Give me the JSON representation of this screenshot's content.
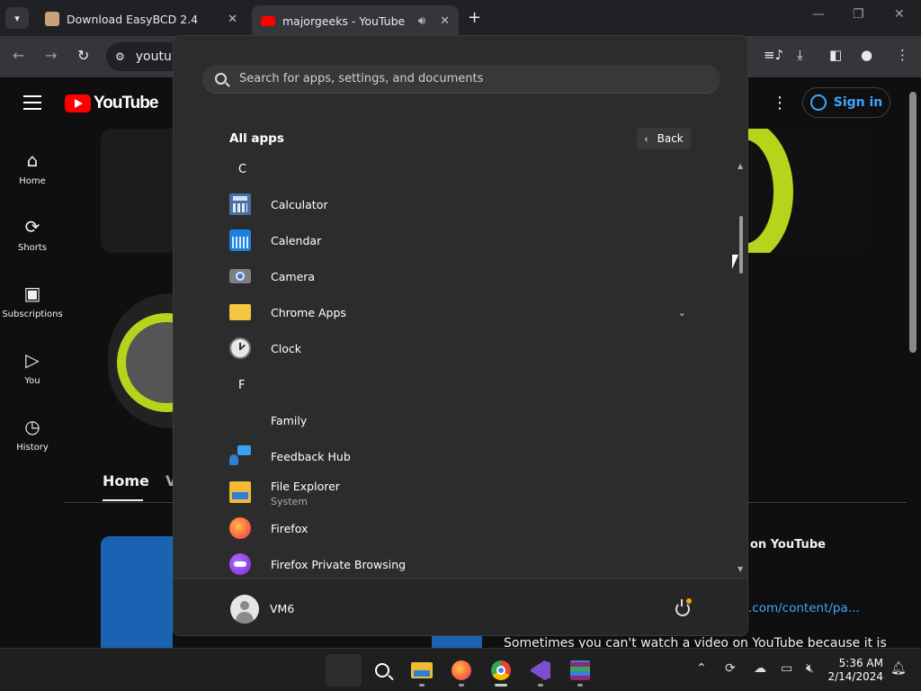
{
  "browser": {
    "tabs": [
      {
        "title": "Download EasyBCD 2.4",
        "favicon": "easybcd-icon"
      },
      {
        "title": "majorgeeks - YouTube",
        "favicon": "youtube-icon",
        "active": true
      }
    ],
    "address_text": "youtu",
    "window_controls": {
      "minimize": "—",
      "maximize": "❐",
      "close": "✕"
    }
  },
  "youtube": {
    "logo_text": "YouTube",
    "sidebar": [
      {
        "label": "Home",
        "icon": "home-icon"
      },
      {
        "label": "Shorts",
        "icon": "shorts-icon"
      },
      {
        "label": "Subscriptions",
        "icon": "subscriptions-icon"
      },
      {
        "label": "You",
        "icon": "you-icon"
      },
      {
        "label": "History",
        "icon": "history-icon"
      }
    ],
    "sign_in": "Sign in",
    "channel_tabs": {
      "home": "Home",
      "videos_partial": "V"
    },
    "about_title": "on YouTube",
    "about_link": ".com/content/pa...",
    "about_desc": "Sometimes you can't watch a video on YouTube because it is"
  },
  "start_menu": {
    "search_placeholder": "Search for apps, settings, and documents",
    "all_apps_title": "All apps",
    "back_label": "Back",
    "letters": {
      "c": "C",
      "f": "F"
    },
    "apps": [
      {
        "name": "Calculator",
        "icon": "calculator-icon"
      },
      {
        "name": "Calendar",
        "icon": "calendar-icon"
      },
      {
        "name": "Camera",
        "icon": "camera-icon"
      },
      {
        "name": "Chrome Apps",
        "icon": "folder-icon",
        "expandable": true
      },
      {
        "name": "Clock",
        "icon": "clock-icon"
      },
      {
        "name": "Family",
        "icon": "family-icon"
      },
      {
        "name": "Feedback Hub",
        "icon": "feedback-hub-icon"
      },
      {
        "name": "File Explorer",
        "subtitle": "System",
        "icon": "file-explorer-icon"
      },
      {
        "name": "Firefox",
        "icon": "firefox-icon"
      },
      {
        "name": "Firefox Private Browsing",
        "icon": "firefox-private-icon"
      }
    ],
    "user_name": "VM6"
  },
  "taskbar": {
    "time": "5:36 AM",
    "date": "2/14/2024"
  },
  "colors": {
    "start_bg": "#2c2c2c",
    "youtube_red": "#ff0000",
    "link_blue": "#3ea6ff",
    "accent_green": "#b5d41b"
  }
}
